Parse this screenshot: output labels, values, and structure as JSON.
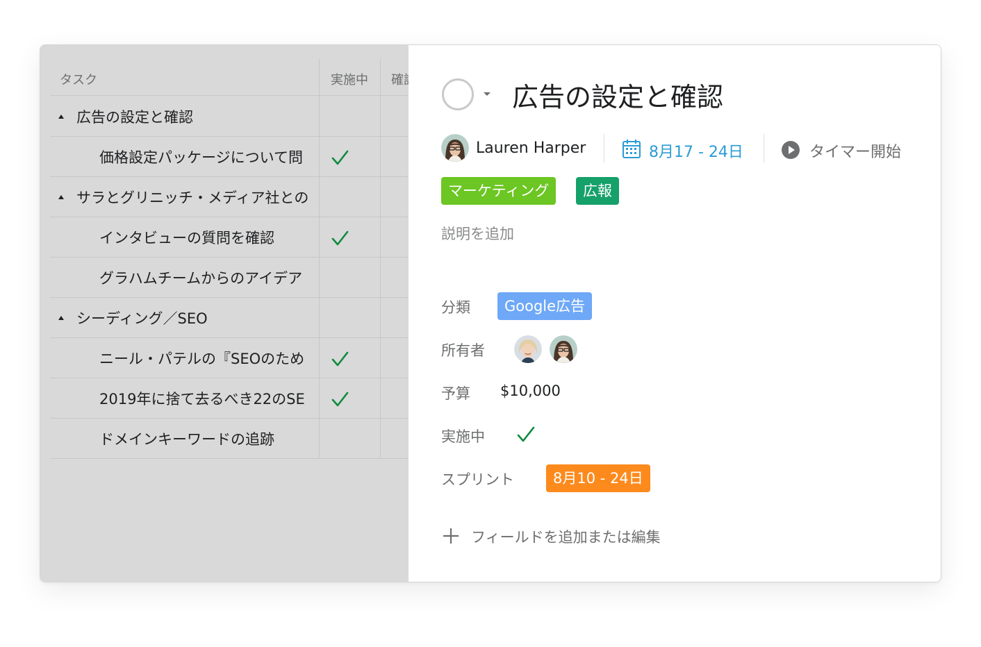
{
  "colors": {
    "check": "#0f8a3e",
    "date": "#2a9cd4",
    "tag_marketing": "#6cc623",
    "tag_pr": "#16a06a",
    "tag_category": "#6ea8f7",
    "tag_sprint": "#fd8a1c"
  },
  "list": {
    "columns": {
      "task": "タスク",
      "col1": "実施中",
      "col2": "確認"
    },
    "rows": [
      {
        "text": "広告の設定と確認",
        "level": "parent",
        "checked": false
      },
      {
        "text": "価格設定パッケージについて問",
        "level": "child",
        "checked": true
      },
      {
        "text": "サラとグリニッチ・メディア社との",
        "level": "parent",
        "checked": false
      },
      {
        "text": "インタビューの質問を確認",
        "level": "child",
        "checked": true
      },
      {
        "text": "グラハムチームからのアイデア",
        "level": "child",
        "checked": false
      },
      {
        "text": "シーディング／SEO",
        "level": "parent",
        "checked": false
      },
      {
        "text": "ニール・パテルの『SEOのため",
        "level": "child",
        "checked": true
      },
      {
        "text": "2019年に捨て去るべき22のSE",
        "level": "child",
        "checked": true
      },
      {
        "text": "ドメインキーワードの追跡",
        "level": "child",
        "checked": false
      }
    ]
  },
  "detail": {
    "title": "広告の設定と確認",
    "assignee": "Lauren Harper",
    "due": "8月17 - 24日",
    "timer": "タイマー開始",
    "tags": [
      "マーケティング",
      "広報"
    ],
    "description_placeholder": "説明を追加",
    "fields": {
      "category_label": "分類",
      "category_value": "Google広告",
      "owner_label": "所有者",
      "budget_label": "予算",
      "budget_value": "$10,000",
      "in_progress_label": "実施中",
      "sprint_label": "スプリント",
      "sprint_value": "8月10 - 24日"
    },
    "add_field": "フィールドを追加または編集"
  }
}
